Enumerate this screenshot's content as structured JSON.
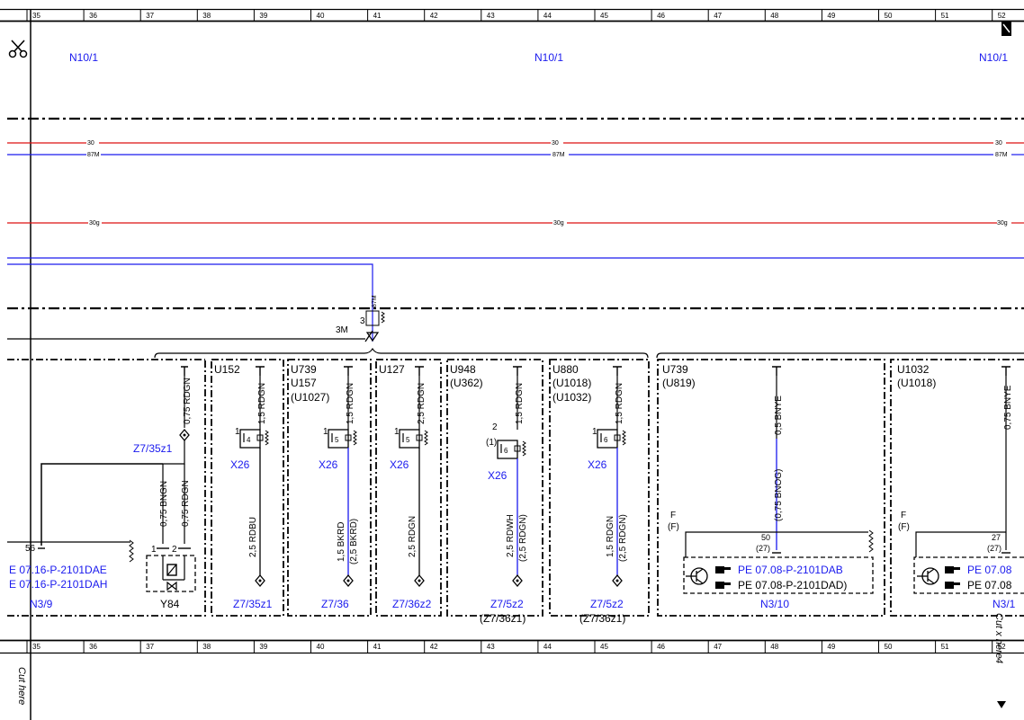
{
  "colors": {
    "red": "#dd1111",
    "blue": "#1a1aee",
    "black": "#000000"
  },
  "icons": {
    "scissors": "scissors-icon",
    "cut_marker": "cut-marker-icon",
    "pointer": "hand-pointer-icon"
  },
  "ruler": {
    "columns": [
      "35",
      "36",
      "37",
      "38",
      "39",
      "40",
      "41",
      "42",
      "43",
      "44",
      "45",
      "46",
      "47",
      "48",
      "49",
      "50",
      "51",
      "52"
    ]
  },
  "header": {
    "n10_1_left": "N10/1",
    "n10_1_center": "N10/1",
    "n10_1_right": "N10/1"
  },
  "buses": {
    "b30_a": "30",
    "b30_b": "30",
    "b30_c": "30",
    "b87m_a": "87M",
    "b87m_b": "87M",
    "b87m_c": "87M",
    "b30g_a": "30g",
    "b30g_b": "30g",
    "b30g_c": "30g"
  },
  "fuse_area": {
    "label_87m": "87M",
    "label_3": "3",
    "label_3m": "3M"
  },
  "left": {
    "wire_top": "0,75 RDGN",
    "connector": "Z7/35z1",
    "wire_a": "0,75 BNGN",
    "wire_b": "0,75 RDGN",
    "pin_56": "56",
    "ref_1": "E 07.16-P-2101DAE",
    "ref_2": "E 07.16-P-2101DAH",
    "n39": "N3/9",
    "pin_1": "1",
    "pin_2": "2",
    "y84": "Y84"
  },
  "groups": [
    {
      "code": "U152",
      "code2": "",
      "code3": "",
      "pin_top": "1",
      "pin_top2": "",
      "pin": "4",
      "wire_top": "1,5 RDGN",
      "x26": "X26",
      "wire_bot": "2,5 RDBU",
      "wire_bot2": "",
      "bottom": "Z7/35z1",
      "bottom2": ""
    },
    {
      "code": "U739",
      "code2": "U157",
      "code3": "(U1027)",
      "pin_top": "1",
      "pin_top2": "",
      "pin": "5",
      "wire_top": "1,5 RDGN",
      "x26": "X26",
      "wire_bot": "1,5 BKRD",
      "wire_bot2": "(2,5 BKRD)",
      "bottom": "Z7/36",
      "bottom2": ""
    },
    {
      "code": "U127",
      "code2": "",
      "code3": "",
      "pin_top": "1",
      "pin_top2": "",
      "pin": "5",
      "wire_top": "2,5 RDGN",
      "x26": "X26",
      "wire_bot": "2,5 RDGN",
      "wire_bot2": "",
      "bottom": "Z7/36z2",
      "bottom2": ""
    },
    {
      "code": "U948",
      "code2": "(U362)",
      "code3": "",
      "pin_top": "2",
      "pin_top2": "(1)",
      "pin": "6",
      "wire_top": "1,5 RDGN",
      "x26": "X26",
      "wire_bot": "2,5 RDWH",
      "wire_bot2": "(2,5 RDGN)",
      "bottom": "Z7/5z2",
      "bottom2": "(Z7/36z1)"
    },
    {
      "code": "U880",
      "code2": "(U1018)",
      "code3": "(U1032)",
      "pin_top": "1",
      "pin_top2": "",
      "pin": "6",
      "wire_top": "1,5 RDGN",
      "x26": "X26",
      "wire_bot": "1,5 RDGN",
      "wire_bot2": "(2,5 RDGN)",
      "bottom": "Z7/5z2",
      "bottom2": "(Z7/36z1)"
    }
  ],
  "right1": {
    "code": "U739",
    "code2": "(U819)",
    "wire": "0,5 BNYE",
    "wire2": "(0,75 BNOG)",
    "f": "F",
    "f2": "(F)",
    "pin": "50",
    "pin2": "(27)",
    "ref_1": "PE 07.08-P-2101DAB",
    "ref_2": "PE 07.08-P-2101DAD)",
    "n310": "N3/10"
  },
  "right2": {
    "code": "U1032",
    "code2": "(U1018)",
    "wire": "0,75 BNYE",
    "f": "F",
    "f2": "(F)",
    "pin": "27",
    "pin2": "(27)",
    "ref_1": "PE 07.08",
    "ref_2": "PE 07.08",
    "n31": "N3/1"
  },
  "footer": {
    "cut_left": "Cut here",
    "cut_right": "Cut x here",
    "page_note": "4"
  }
}
